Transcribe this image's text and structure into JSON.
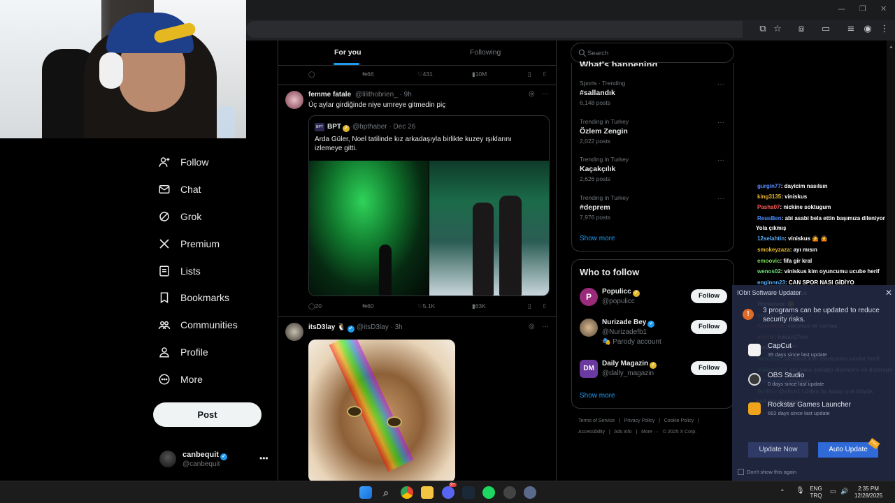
{
  "browser": {
    "window_controls": [
      "—",
      "❐",
      "✕"
    ]
  },
  "nav": {
    "items": [
      {
        "label": "Follow",
        "icon": "person-plus-icon"
      },
      {
        "label": "Chat",
        "icon": "mail-icon"
      },
      {
        "label": "Grok",
        "icon": "grok-icon"
      },
      {
        "label": "Premium",
        "icon": "x-logo-icon"
      },
      {
        "label": "Lists",
        "icon": "list-icon"
      },
      {
        "label": "Bookmarks",
        "icon": "bookmark-icon"
      },
      {
        "label": "Communities",
        "icon": "people-icon"
      },
      {
        "label": "Profile",
        "icon": "person-icon"
      },
      {
        "label": "More",
        "icon": "more-circle-icon"
      }
    ],
    "post_label": "Post",
    "account": {
      "name": "canbequit",
      "handle": "@canbequit",
      "more": "•••"
    }
  },
  "timeline": {
    "tabs": [
      {
        "label": "For you"
      },
      {
        "label": "Following"
      }
    ],
    "prev_actions": {
      "replies": "",
      "reposts": "66",
      "likes": "431",
      "views": "10M"
    },
    "tweet1": {
      "name": "femme fatale",
      "handle": "@lilithobrien_",
      "time": "· 9h",
      "text": "Üç aylar girdiğinde niye umreye gitmedin piç",
      "quote": {
        "logo": "BPT",
        "name": "BPT",
        "handle": "@bpthaber",
        "time": "· Dec 26",
        "text": "Arda Güler, Noel tatilinde kız arkadaşıyla birlikte kuzey ışıklarını izlemeye gitti."
      },
      "actions": {
        "replies": "20",
        "reposts": "60",
        "likes": "5.1K",
        "views": "63K"
      }
    },
    "tweet2": {
      "name": "itsD3lay",
      "emoji": "🐧",
      "handle": "@itsD3lay",
      "time": "· 3h"
    }
  },
  "sidebar": {
    "search_placeholder": "Search",
    "happening_title": "What's happening",
    "trends": [
      {
        "category": "Sports · Trending",
        "name": "#sallandık",
        "count": "6,148 posts"
      },
      {
        "category": "Trending in Turkey",
        "name": "Özlem Zengin",
        "count": "2,022 posts"
      },
      {
        "category": "Trending in Turkey",
        "name": "Kaçakçılık",
        "count": "2,626 posts"
      },
      {
        "category": "Trending in Turkey",
        "name": "#deprem",
        "count": "7,976 posts"
      }
    ],
    "show_more": "Show more",
    "who_title": "Who to follow",
    "who": [
      {
        "name": "Populicc",
        "handle": "@populicc",
        "extra": "",
        "badge": "gold",
        "avatar_color": "#9a2a7a"
      },
      {
        "name": "Nurizade Bey",
        "handle": "@Nurizadefb1",
        "extra": "🎭 Parody account",
        "badge": "blue",
        "avatar_color": "#5a4a3a"
      },
      {
        "name": "Daily Magazin",
        "handle": "@dally_magazin",
        "extra": "",
        "badge": "gold",
        "avatar_color": "#6a3aa0"
      }
    ],
    "follow_label": "Follow",
    "footer_line1": [
      "Terms of Service",
      "|",
      "Privacy Policy",
      "|",
      "Cookie Policy",
      "|"
    ],
    "footer_line2": [
      "Accessibility",
      "|",
      "Ads info",
      "|",
      "More ···",
      "© 2025 X Corp."
    ]
  },
  "chat": [
    {
      "user": "gurgin77",
      "color": "#5b8cff",
      "text": ": dayicim nasılsın"
    },
    {
      "user": "king3135",
      "color": "#e8b830",
      "text": ": viniskus"
    },
    {
      "user": "Pasha07",
      "color": "#ff5a5a",
      "text": ": nickine soktugum"
    },
    {
      "user": "ReusBen",
      "color": "#4a8fff",
      "text": ": abi asabi bela ettin başımıza dileniyor"
    },
    {
      "user": "",
      "color": "#ffffff",
      "text": "Yola çıkmış"
    },
    {
      "user": "12selahtin",
      "color": "#5ab0ff",
      "text": ": viniskus 🤷 🤷"
    },
    {
      "user": "smokeyzaza",
      "color": "#e8b830",
      "text": ": ayı mısın"
    },
    {
      "user": "emoovic",
      "color": "#7bd65a",
      "text": ": fifa gir kral"
    },
    {
      "user": "wenos02",
      "color": "#6ee07a",
      "text": ": viniskus kim oyuncumu ucube herif"
    },
    {
      "user": "enginnn23",
      "color": "#5ab0ff",
      "text": ": CAN SPOR NASI GİDİYO"
    },
    {
      "user": "king3135",
      "color": "#e8b830",
      "text": ": viniskus"
    },
    {
      "user": "Warkerem",
      "color": "#ffffff",
      "text": ": 🙂"
    },
    {
      "user": "ssari21",
      "color": "#6ee07a",
      "text": ": aysın"
    },
    {
      "user": "Kerem636",
      "color": "#ff5a5a",
      "text": ": viniskus ne yarraw"
    },
    {
      "user": "mhrnk",
      "color": "#ff8a3a",
      "text": ": hakan27cm"
    },
    {
      "user": "cusar7676",
      "color": "#ffffff",
      "text": ": ****"
    },
    {
      "user": "wenos02",
      "color": "#6ee07a",
      "text": ": viniskus kim oyuncumu ucube herif"
    },
    {
      "user": "enikeray13",
      "color": "#6ee07a",
      "text": ": abi sana şeriatçı diyenlere ne diyorsun"
    },
    {
      "user": "Tuselahtin",
      "color": "#5ab0ff",
      "text": ": viniskus"
    },
    {
      "user": "BotRix",
      "color": "#7bd65a",
      "text": ": @nilcn1 Lütfen bu kadar çok büyük"
    },
    {
      "user": "",
      "color": "#ffffff",
      "text": "harf göndermeyin."
    }
  ],
  "iobit": {
    "title": "IObit Software Updater",
    "close": "✕",
    "message": "3 programs can be updated to reduce security risks.",
    "programs": [
      {
        "name": "CapCut",
        "status": "35 days since last update",
        "color": "#f2f2f2"
      },
      {
        "name": "OBS Studio",
        "status": "0 days since last update",
        "color": "#3a3a3a"
      },
      {
        "name": "Rockstar Games Launcher",
        "status": "662 days since last update",
        "color": "#f0a41c"
      }
    ],
    "update_now": "Update Now",
    "auto_update": "Auto Update",
    "pro": "PRO",
    "dont_show": "Don't show this again"
  },
  "taskbar": {
    "lang1": "ENG",
    "lang2": "TRQ",
    "time": "2:35 PM",
    "date": "12/28/2025",
    "discord_badge": "9+"
  }
}
